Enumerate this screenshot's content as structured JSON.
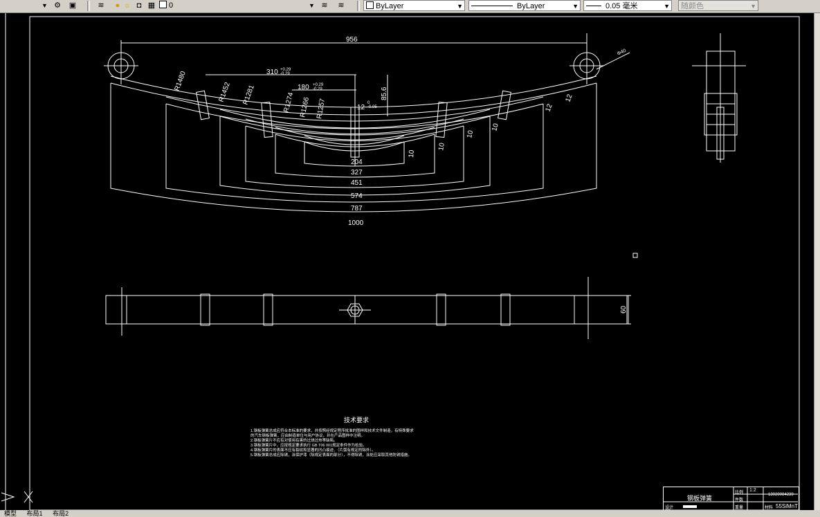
{
  "toolbar": {
    "layer_value": "0",
    "color_value": "ByLayer",
    "linetype_value": "ByLayer",
    "lineweight_value": "0.05 毫米",
    "plotstyle_value": "随颜色"
  },
  "tabs": [
    "模型",
    "布局1",
    "布局2"
  ],
  "dimensions": {
    "overall_length": "956",
    "eye_diameter": "Φ40",
    "center_offset": "310",
    "center_offset_tol_upper": "+0.29",
    "center_offset_tol_lower": "-0.29",
    "center_hole": "180",
    "center_hole_tol_upper": "+0.29",
    "center_hole_tol_lower": "-0.29",
    "height": "85.6",
    "bolt": "12",
    "bolt_tol_upper": "0",
    "bolt_tol_lower": "-0.05",
    "radii": [
      "R1480",
      "R1452",
      "R1281",
      "R1274",
      "R1266",
      "R1257"
    ],
    "leaf_lengths": [
      "204",
      "327",
      "451",
      "574",
      "787",
      "1000"
    ],
    "thickness_labels": [
      "12",
      "12",
      "10",
      "10",
      "10",
      "10"
    ],
    "width": "60"
  },
  "tech_requirements": {
    "title": "技术要求",
    "lines": [
      "1.钢板弹簧总成应符合本标准的要求，并按照经规定程序批准的图样和技术文件制造，有特殊要求",
      "   的汽车钢板弹簧，应由制造单位与用户协议，并在产品图样中注明。",
      "2.钢板弹簧片不应有对使用有害的过烧过热等缺陷。",
      "3.钢板弹簧片中，应按规定要求执行 GB T06 001规定条件作为检验。",
      "4.钢板弹簧片的表面不应有裂纹和显著的凹凸痕迹、（片弧有规定的除外）。",
      "5.钢板弹簧总成应除锈，涂保护漆（除规定表面的部分），不得除锈，涂处应采取其他防锈措施。"
    ]
  },
  "title_block": {
    "name": "钢板弹簧",
    "scale_label": "比例",
    "scale_value": "1:2",
    "qty_label": "件数",
    "qty_value": "",
    "weight_label": "重量",
    "drawing_no": "13020084239",
    "design_label": "设计",
    "review_label": "审核",
    "material_label": "材料",
    "material_value": "55SiMnT"
  },
  "colors": {
    "background": "#000000",
    "lines": "#ffffff",
    "toolbar": "#d4d0c8"
  }
}
